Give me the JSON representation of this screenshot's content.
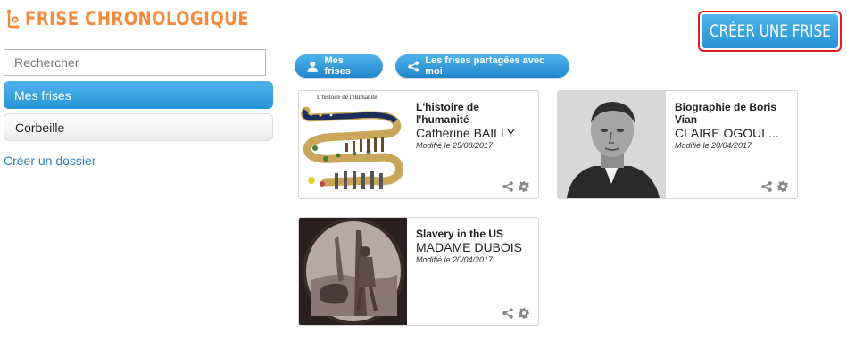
{
  "app": {
    "title": "FRISE CHRONOLOGIQUE",
    "brand_color": "#f58a3c",
    "accent_color": "#2d9ee0"
  },
  "header": {
    "create_button_label": "CRÉER UNE FRISE"
  },
  "sidebar": {
    "search_placeholder": "Rechercher",
    "items": [
      {
        "label": "Mes frises",
        "active": true
      },
      {
        "label": "Corbeille",
        "active": false
      }
    ],
    "create_folder_label": "Créer un dossier"
  },
  "tabs": [
    {
      "label": "Mes frises",
      "icon": "user-icon"
    },
    {
      "label": "Les frises partagées avec moi",
      "icon": "share-icon"
    }
  ],
  "cards": [
    {
      "title": "L'histoire de l'humanité",
      "author": "Catherine BAILLY",
      "modified": "Modifié le 25/08/2017",
      "thumbnail_caption": "L'histoire de l'Humanité"
    },
    {
      "title": "Biographie de Boris Vian",
      "author": "CLAIRE OGOUL...",
      "modified": "Modifié le 20/04/2017"
    },
    {
      "title": "Slavery in the US",
      "author": "MADAME DUBOIS",
      "modified": "Modifié le 20/04/2017"
    }
  ]
}
